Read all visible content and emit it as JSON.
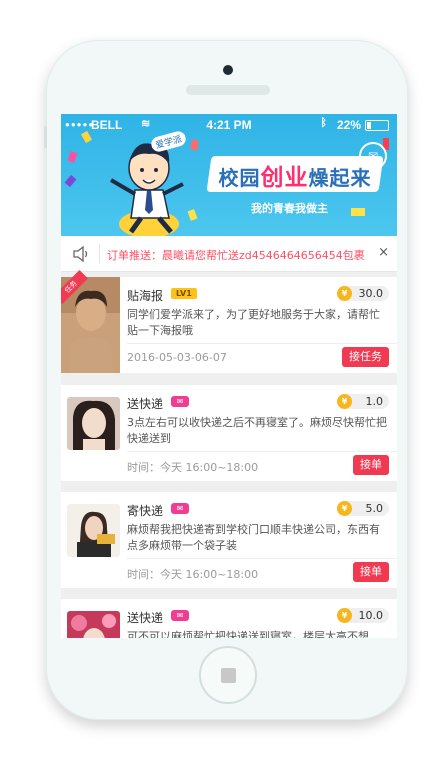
{
  "status_bar": {
    "carrier": "BELL",
    "time": "4:21 PM",
    "battery": "22%",
    "battery_level": 0.22
  },
  "banner": {
    "badge": "爱学派",
    "headline_part1": "校园",
    "headline_highlight": "创业",
    "headline_part2": "燥起来",
    "slogan": "我的青春我做主",
    "mail_icon": "mail-icon"
  },
  "notice": {
    "icon": "speaker-icon",
    "text": "订单推送：晨曦请您帮忙送zd454646465645​4包裹",
    "close": "×"
  },
  "tasks": [
    {
      "title": "贴海报",
      "level": "LV1",
      "corner_tag": "任务",
      "price": "30.0",
      "coin": "¥",
      "desc": "同学们爱学派来了，为了更好地服务于大家，请帮忙贴一下海报哦",
      "time": "2016-05-03-06-07",
      "button": "接任务"
    },
    {
      "title": "送快递",
      "price": "1.0",
      "coin": "¥",
      "desc": "3点左右可以收快递之后不再寝室了。麻烦尽快帮忙把快递送到",
      "time": "时间：今天 16:00~18:00",
      "button": "接单"
    },
    {
      "title": "寄快递",
      "price": "5.0",
      "coin": "¥",
      "desc": "麻烦帮我把快递寄到学校门口顺丰快递公司，东西有点多麻烦带一个袋子装",
      "time": "时间：今天 16:00~18:00",
      "button": "接单"
    },
    {
      "title": "送快递",
      "price": "10.0",
      "coin": "¥",
      "desc": "可不可以麻烦帮忙把快递送到寝室，楼层太高不想",
      "time": "",
      "button": ""
    }
  ],
  "colors": {
    "accent": "#f03a52",
    "banner": "#2fb3e6",
    "notice_text": "#ff4e63",
    "coin": "#f7b51e",
    "level_badge": "#ffc21a",
    "pink_tag": "#f03d93"
  }
}
